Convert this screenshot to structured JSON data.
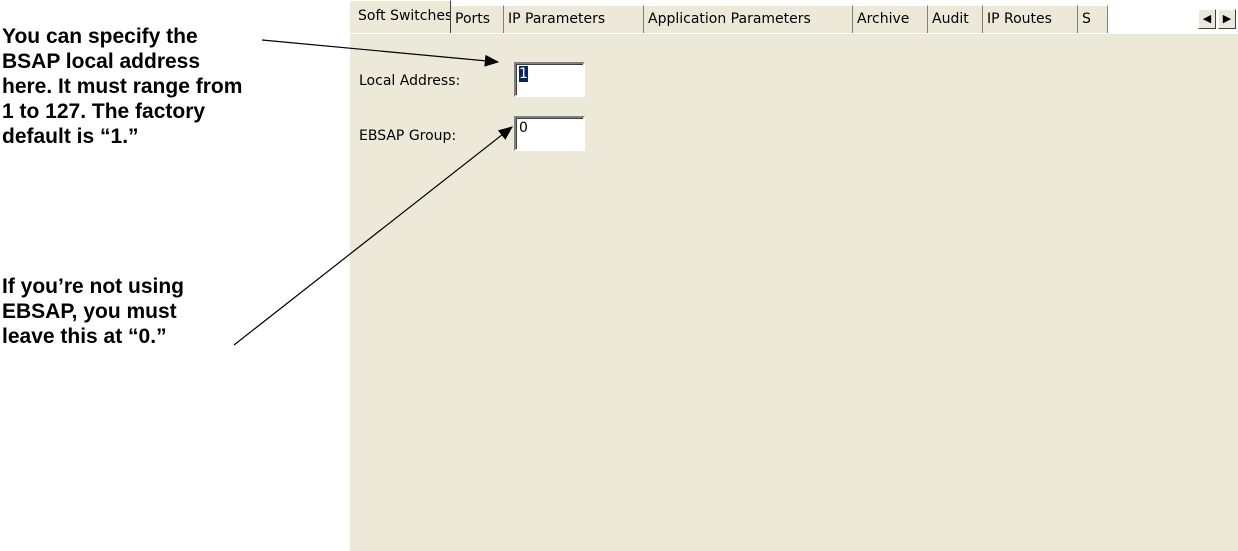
{
  "callouts": {
    "local_address_note": "You can specify the\nBSAP local address\nhere. It must range from\n1 to 127. The factory\ndefault is “1.”",
    "ebsap_note": "If you’re not using\nEBSAP, you must\nleave this at “0.”"
  },
  "tabs": [
    {
      "label": "Soft Switches",
      "active": true
    },
    {
      "label": "Ports"
    },
    {
      "label": "IP Parameters"
    },
    {
      "label": "Application Parameters"
    },
    {
      "label": "Archive"
    },
    {
      "label": "Audit"
    },
    {
      "label": "IP Routes"
    },
    {
      "label": "S"
    }
  ],
  "scroll_icons": {
    "left": "arrow-left-icon",
    "right": "arrow-right-icon"
  },
  "form": {
    "local_address": {
      "label": "Local Address:",
      "value": "1"
    },
    "ebsap_group": {
      "label": "EBSAP Group:",
      "value": "0"
    }
  },
  "colors": {
    "panel_bg": "#ece9d8",
    "selection": "#0a246a"
  }
}
